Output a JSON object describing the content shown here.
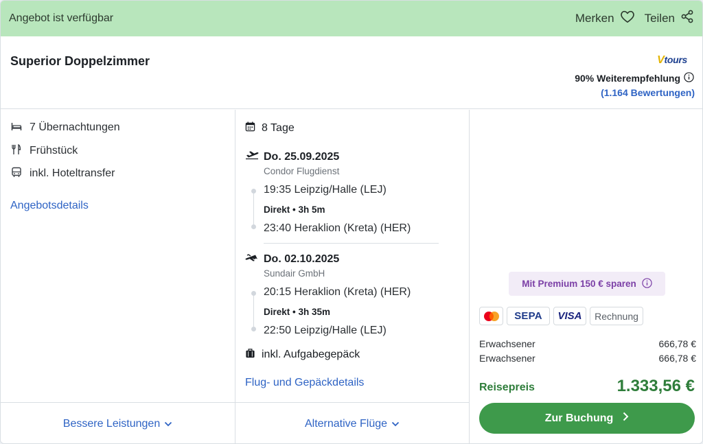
{
  "topbar": {
    "availability": "Angebot ist verfügbar",
    "save_label": "Merken",
    "share_label": "Teilen"
  },
  "header": {
    "room_title": "Superior Doppelzimmer",
    "brand_logo_text": "tours",
    "brand_logo_initial": "V",
    "recommendation": "90% Weiterempfehlung",
    "reviews": "(1.164 Bewertungen)"
  },
  "features": {
    "nights": "7 Übernachtungen",
    "board": "Frühstück",
    "transfer": "inkl. Hoteltransfer",
    "details_link": "Angebotsdetails"
  },
  "trip": {
    "duration": "8 Tage",
    "outbound": {
      "date": "Do. 25.09.2025",
      "airline": "Condor Flugdienst",
      "departure": "19:35 Leipzig/Halle (LEJ)",
      "direct": "Direkt • 3h 5m",
      "arrival": "23:40 Heraklion (Kreta) (HER)"
    },
    "return": {
      "date": "Do. 02.10.2025",
      "airline": "Sundair GmbH",
      "departure": "20:15 Heraklion (Kreta) (HER)",
      "direct": "Direkt • 3h 35m",
      "arrival": "22:50 Leipzig/Halle (LEJ)"
    },
    "baggage": "inkl. Aufgabegepäck",
    "details_link": "Flug- und Gepäckdetails"
  },
  "pricing": {
    "premium": "Mit Premium 150 € sparen",
    "payment_methods": [
      "Mastercard",
      "SEPA",
      "VISA",
      "Rechnung"
    ],
    "sepa_label": "SEPA",
    "visa_label": "VISA",
    "invoice_label": "Rechnung",
    "travelers": [
      {
        "label": "Erwachsener",
        "price": "666,78 €"
      },
      {
        "label": "Erwachsener",
        "price": "666,78 €"
      }
    ],
    "total_label": "Reisepreis",
    "total_value": "1.333,56 €",
    "book_label": "Zur Buchung"
  },
  "footer": {
    "better_services": "Bessere Leistungen",
    "alternative_flights": "Alternative Flüge"
  },
  "colors": {
    "topbar_bg": "#b8e6bc",
    "link": "#2e63c4",
    "price_green": "#2e7d3a",
    "button_green": "#3e9a4b",
    "premium_purple": "#7b3fa6"
  }
}
